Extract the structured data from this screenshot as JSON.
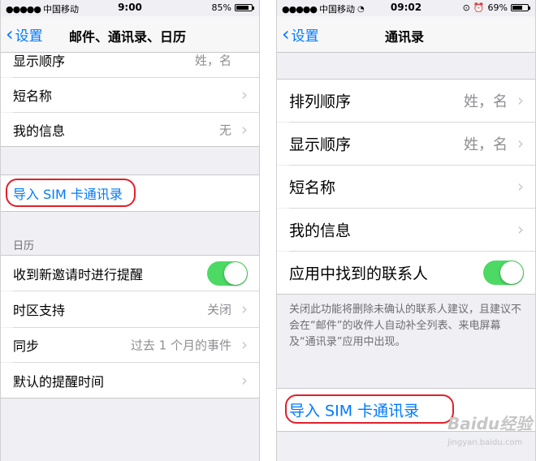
{
  "left": {
    "status": {
      "carrier": "中国移动",
      "time": "9:00",
      "battery": "85%",
      "battery_level": 0.85
    },
    "nav": {
      "back": "设置",
      "title": "邮件、通讯录、日历"
    },
    "rows": {
      "display_order": {
        "label": "显示顺序",
        "value": "姓，名"
      },
      "short_name": {
        "label": "短名称"
      },
      "my_info": {
        "label": "我的信息",
        "value": "无"
      },
      "import_sim": {
        "label": "导入 SIM 卡通讯录"
      },
      "calendar_header": "日历",
      "invite_alert": {
        "label": "收到新邀请时进行提醒",
        "toggle": "on"
      },
      "timezone": {
        "label": "时区支持",
        "value": "关闭"
      },
      "sync": {
        "label": "同步",
        "value": "过去 1 个月的事件"
      },
      "default_alert": {
        "label": "默认的提醒时间"
      }
    }
  },
  "right": {
    "status": {
      "carrier": "中国移动",
      "time": "09:02",
      "battery": "69%",
      "battery_level": 0.69
    },
    "nav": {
      "back": "设置",
      "title": "通讯录"
    },
    "rows": {
      "sort_order": {
        "label": "排列顺序",
        "value": "姓，名"
      },
      "display_order": {
        "label": "显示顺序",
        "value": "姓，名"
      },
      "short_name": {
        "label": "短名称"
      },
      "my_info": {
        "label": "我的信息"
      },
      "found_contacts": {
        "label": "应用中找到的联系人",
        "toggle": "on"
      },
      "footnote": "关闭此功能将删除未确认的联系人建议，且建议不会在“邮件”的收件人自动补全列表、来电屏幕及“通讯录”应用中出现。",
      "import_sim": {
        "label": "导入 SIM 卡通讯录"
      }
    }
  },
  "watermark": {
    "brand": "Baidu经验",
    "url": "jingyan.baidu.com"
  },
  "colors": {
    "accent": "#007aff",
    "toggle_on": "#4cd964",
    "highlight_ring": "#e0202a"
  }
}
